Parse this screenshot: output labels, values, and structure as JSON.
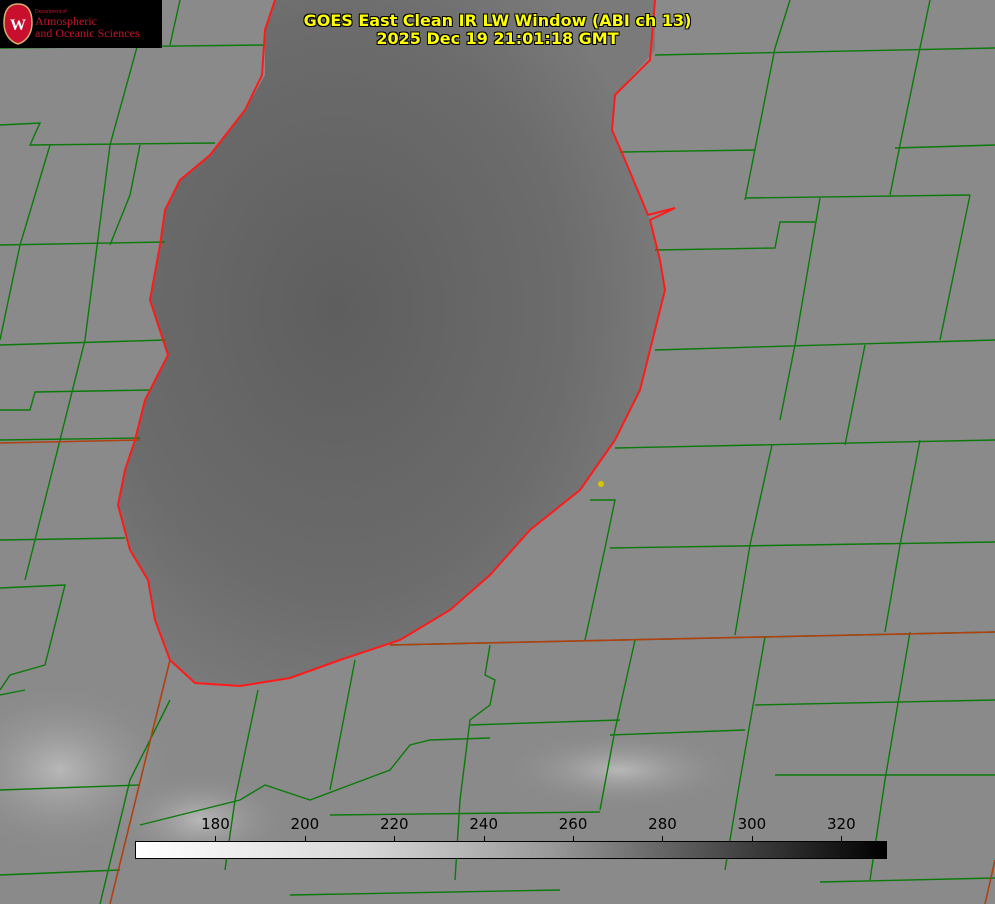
{
  "logo": {
    "dept": "Department of",
    "line1": "Atmospheric",
    "line2": "and Oceanic Sciences"
  },
  "title": {
    "line1": "GOES East Clean IR LW Window (ABI ch 13)",
    "line2": "2025 Dec 19 21:01:18 GMT"
  },
  "colorbar": {
    "min": 162,
    "max": 330,
    "ticks": [
      "180",
      "200",
      "220",
      "240",
      "260",
      "280",
      "300",
      "320"
    ],
    "tick_values": [
      180,
      200,
      220,
      240,
      260,
      280,
      300,
      320
    ],
    "colors": [
      "#ffffff",
      "#000000"
    ]
  },
  "colors": {
    "county_lines": "#0a7a0a",
    "shoreline": "#ff1a1a",
    "title": "#ffff00",
    "marker": "#d4c800"
  }
}
